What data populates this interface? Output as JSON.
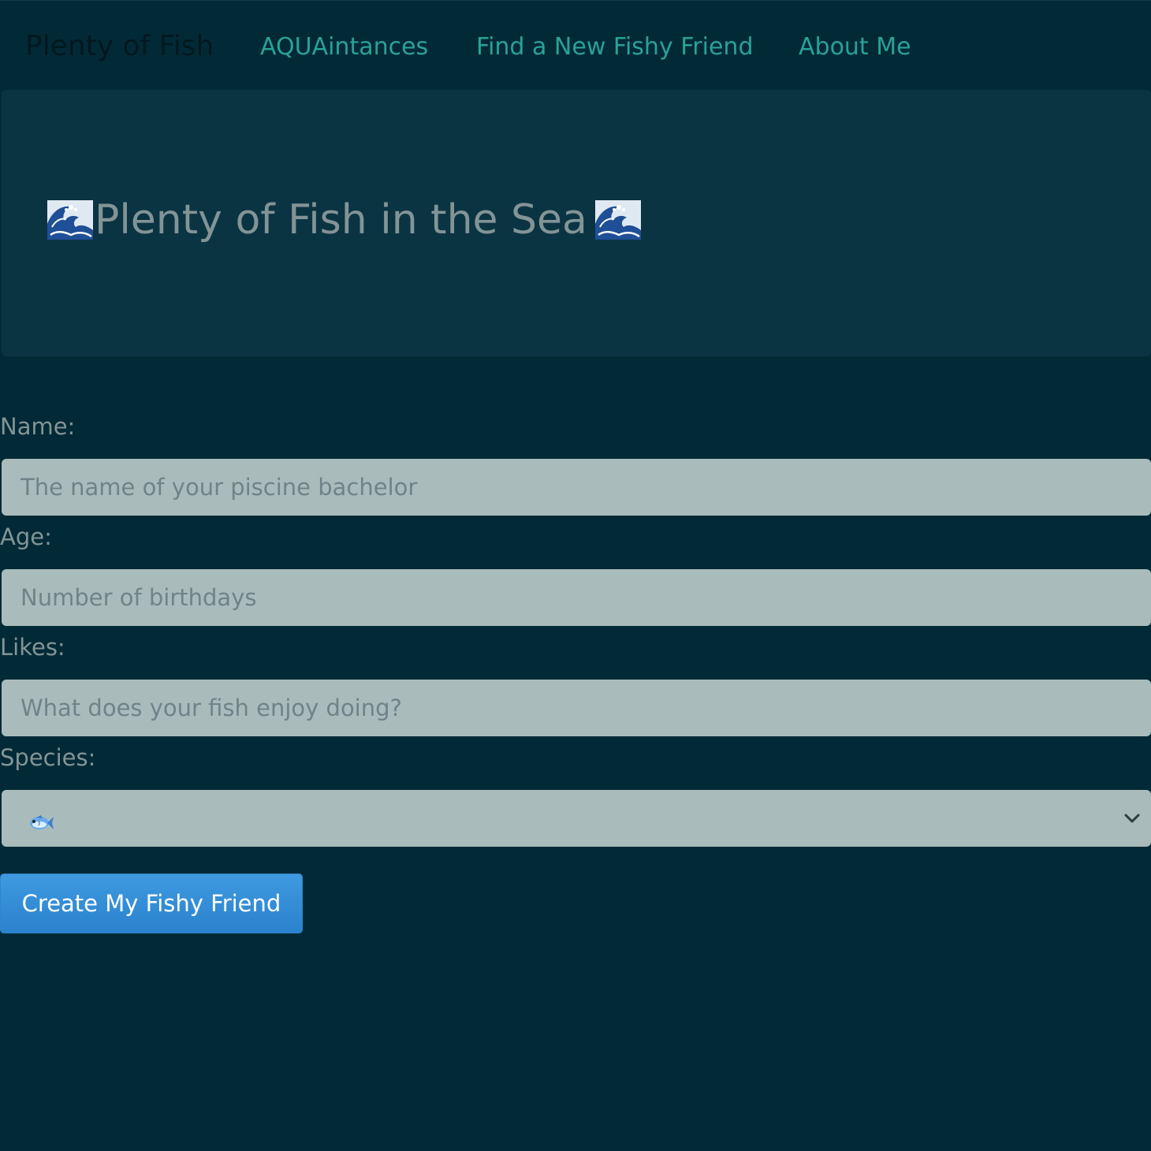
{
  "navbar": {
    "brand": "Plenty of Fish",
    "links": [
      "AQUAintances",
      "Find a New Fishy Friend",
      "About Me"
    ]
  },
  "jumbotron": {
    "title": "Plenty of Fish in the Sea",
    "icon": "wave-icon"
  },
  "form": {
    "name": {
      "label": "Name:",
      "placeholder": "The name of your piscine bachelor",
      "value": ""
    },
    "age": {
      "label": "Age:",
      "placeholder": "Number of birthdays",
      "value": ""
    },
    "likes": {
      "label": "Likes:",
      "placeholder": "What does your fish enjoy doing?",
      "value": ""
    },
    "species": {
      "label": "Species:",
      "selected_icon": "fish-icon"
    },
    "submit_label": "Create My Fishy Friend"
  },
  "colors": {
    "background": "#022a36",
    "jumbotron": "#0b3443",
    "link": "#2aa198",
    "muted_text": "#839496",
    "input_bg": "#a9bcbb",
    "button": "#3a93d8"
  }
}
